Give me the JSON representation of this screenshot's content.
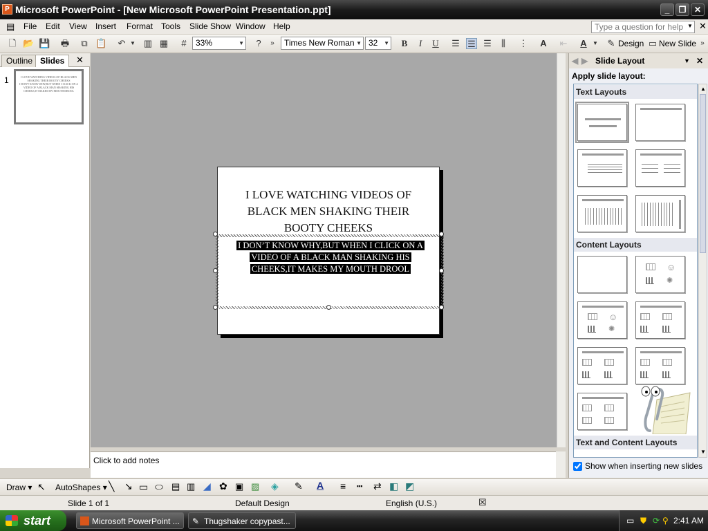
{
  "window": {
    "title": "Microsoft PowerPoint - [New Microsoft PowerPoint Presentation.ppt]"
  },
  "menu": [
    "File",
    "Edit",
    "View",
    "Insert",
    "Format",
    "Tools",
    "Slide Show",
    "Window",
    "Help"
  ],
  "help_search": {
    "placeholder": "Type a question for help"
  },
  "toolbar": {
    "zoom": "33%",
    "font": "Times New Roman",
    "font_size": "32",
    "design_label": "Design",
    "new_slide_label": "New Slide"
  },
  "left_pane": {
    "tabs": [
      "Outline",
      "Slides"
    ],
    "slide_number": "1",
    "thumb_title": "I LOVE WATCHING VIDEOS OF BLACK MEN SHAKING THEIR BOOTY CHEEKS",
    "thumb_body": "I DON'T KNOW WHY,BUT WHEN I CLICK ON A VIDEO OF A BLACK MAN SHAKING HIS CHEEKS,IT MAKES MY MOUTH DROOL"
  },
  "slide": {
    "title_lines": [
      "I LOVE WATCHING VIDEOS OF",
      "BLACK MEN SHAKING THEIR",
      "BOOTY CHEEKS"
    ],
    "body_lines": [
      "I DON’T KNOW WHY,BUT WHEN I CLICK ON A",
      "VIDEO OF A BLACK MAN SHAKING HIS",
      "CHEEKS,IT MAKES MY MOUTH DROOL"
    ]
  },
  "notes": {
    "placeholder": "Click to add notes"
  },
  "task_pane": {
    "title": "Slide Layout",
    "apply_label": "Apply slide layout:",
    "groups": [
      "Text Layouts",
      "Content Layouts",
      "Text and Content Layouts"
    ],
    "show_checkbox": {
      "label": "Show when inserting new slides",
      "checked": true
    }
  },
  "draw_toolbar": {
    "draw_label": "Draw",
    "autoshapes_label": "AutoShapes"
  },
  "status": {
    "slide": "Slide 1 of 1",
    "design": "Default Design",
    "language": "English (U.S.)"
  },
  "taskbar": {
    "start_label": "start",
    "tasks": [
      "Microsoft PowerPoint ...",
      "Thugshaker copypast..."
    ],
    "clock": "2:41 AM"
  }
}
